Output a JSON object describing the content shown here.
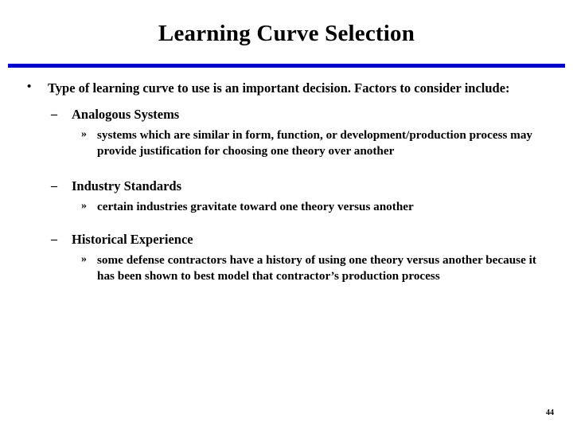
{
  "slide": {
    "title": "Learning Curve Selection",
    "page_number": "44",
    "accent_color": "#0000cc",
    "content": [
      {
        "level": 1,
        "bullet": "•",
        "text": "Type of learning curve to use is an important decision.  Factors to consider include:"
      },
      {
        "level": 2,
        "bullet": "–",
        "text": "Analogous Systems"
      },
      {
        "level": 3,
        "bullet": "»",
        "text": "systems which are similar in form, function, or development/production process may provide justification for choosing one theory over another"
      },
      {
        "level": 2,
        "bullet": "–",
        "text": "Industry Standards"
      },
      {
        "level": 3,
        "bullet": "»",
        "text": "certain industries gravitate toward one theory versus another"
      },
      {
        "level": 2,
        "bullet": "–",
        "text": "Historical Experience"
      },
      {
        "level": 3,
        "bullet": "»",
        "text": "some defense contractors have a history of using one theory versus another because it has been shown to best model that contractor’s production process"
      }
    ]
  }
}
